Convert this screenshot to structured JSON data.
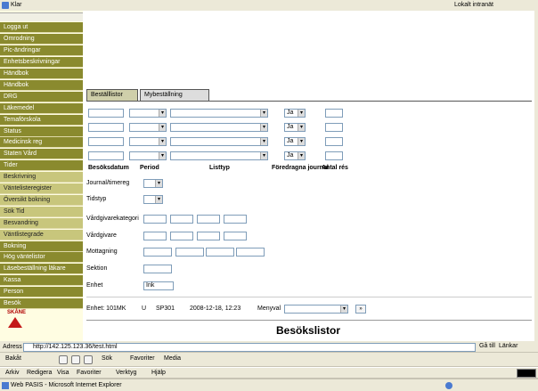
{
  "window": {
    "title": "Web PASIS - Microsoft Internet Explorer"
  },
  "menu": [
    "Arkiv",
    "Redigera",
    "Visa",
    "Favoriter",
    "Verktyg",
    "Hjälp"
  ],
  "toolbar": {
    "back": "Bakåt",
    "search": "Sök",
    "favorites": "Favoriter",
    "media": "Media"
  },
  "address": {
    "label": "Adress",
    "url": "http://142.125.123.36/test.html",
    "go": "Gå till",
    "links": "Länkar"
  },
  "status": {
    "left": "Klar",
    "right": "Lokalt intranät"
  },
  "logo": {
    "text": "SKÅNE"
  },
  "sidebar": {
    "items": [
      {
        "label": "Besök",
        "sub": false
      },
      {
        "label": "Person",
        "sub": false
      },
      {
        "label": "Kassa",
        "sub": false
      },
      {
        "label": "Läsebeställning läkare",
        "sub": false
      },
      {
        "label": "Hög väntelistor",
        "sub": false
      },
      {
        "label": "Bokning",
        "sub": false
      },
      {
        "label": "Väntlistegrade",
        "sub": true
      },
      {
        "label": "Besvandring",
        "sub": true
      },
      {
        "label": "Sök Tid",
        "sub": true
      },
      {
        "label": "Översikt bokning",
        "sub": true
      },
      {
        "label": "Väntelisteregister",
        "sub": true
      },
      {
        "label": "Beskrivning",
        "sub": true
      },
      {
        "label": "Tider",
        "sub": false
      },
      {
        "label": "Staten Vård",
        "sub": false
      },
      {
        "label": "Medicinsk reg",
        "sub": false
      },
      {
        "label": "Status",
        "sub": false
      },
      {
        "label": "Temaförskola",
        "sub": false
      },
      {
        "label": "Läkemedel",
        "sub": false
      },
      {
        "label": "DRG",
        "sub": false
      },
      {
        "label": "Händbok",
        "sub": false
      },
      {
        "label": "Händbok",
        "sub": false
      },
      {
        "label": "Enhetsbeskrivningar",
        "sub": false
      },
      {
        "label": "Pic-ändringar",
        "sub": false
      },
      {
        "label": "Omrodning",
        "sub": false
      },
      {
        "label": "Logga ut",
        "sub": false
      }
    ]
  },
  "page": {
    "title": "Besökslistor",
    "summary_left": "Enhet: 101MK",
    "summary_mid": "U",
    "summary_code": "SP301",
    "summary_date": "2008-12-18, 12:23",
    "menuval_label": "Menyval",
    "enhet_label": "Enhet",
    "enhet_value": "Ink",
    "sektion_label": "Sektion",
    "mottagning_label": "Mottagning",
    "vardgivare_label": "Vårdgivare",
    "vardgivarekategori_label": "Vårdgivarekategori",
    "tidstypn_label": "Tidstyp",
    "journaltimereg_label": "Journal/timereg",
    "headers": {
      "col1": "Besöksdatum",
      "col2": "Period",
      "col3": "Listtyp",
      "col4": "Föredragna journal",
      "col5": "Antal rés"
    },
    "rowdata": [
      "Ja",
      "Ja",
      "Ja",
      "Ja"
    ],
    "tabs": [
      "Beställlistor",
      "Mybeställning"
    ]
  }
}
